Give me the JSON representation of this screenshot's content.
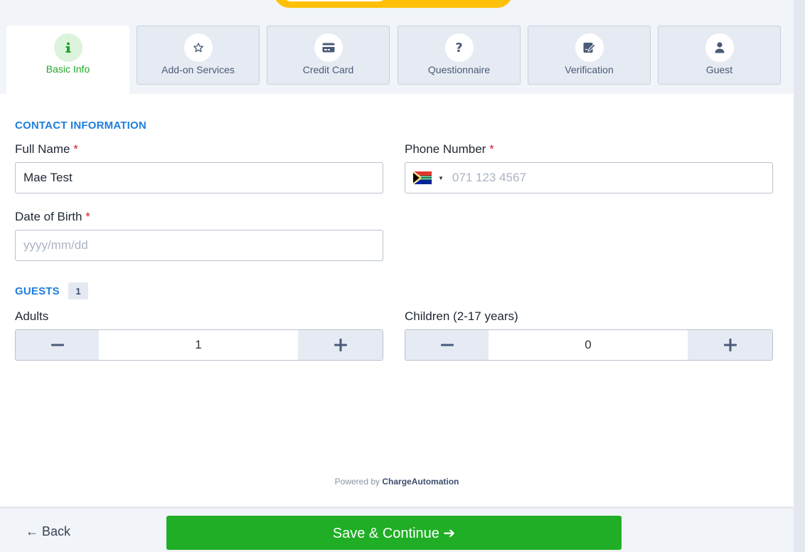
{
  "tabs": [
    {
      "label": "Basic Info",
      "icon": "info-icon",
      "active": true
    },
    {
      "label": "Add-on Services",
      "icon": "star-icon"
    },
    {
      "label": "Credit Card",
      "icon": "credit-card-icon"
    },
    {
      "label": "Questionnaire",
      "icon": "question-icon"
    },
    {
      "label": "Verification",
      "icon": "signature-icon"
    },
    {
      "label": "Guest",
      "icon": "user-icon"
    }
  ],
  "contact": {
    "title": "CONTACT INFORMATION",
    "full_name": {
      "label": "Full Name",
      "required": "*",
      "value": "Mae Test"
    },
    "phone": {
      "label": "Phone Number",
      "required": "*",
      "placeholder": "071 123 4567",
      "flag": "south-africa-flag-icon"
    },
    "dob": {
      "label": "Date of Birth",
      "required": "*",
      "placeholder": "yyyy/mm/dd"
    }
  },
  "guests": {
    "title": "GUESTS",
    "count": "1",
    "adults": {
      "label": "Adults",
      "value": "1"
    },
    "children": {
      "label": "Children (2-17 years)",
      "value": "0"
    }
  },
  "powered": {
    "prefix": "Powered by",
    "brand": "ChargeAutomation"
  },
  "footer": {
    "back_label": "← Back",
    "save_label": "Save & Continue ➔"
  },
  "colors": {
    "accent_green": "#1fae25",
    "accent_blue": "#1f7ddc",
    "required_red": "#d0202e",
    "top_pill": "#ffc107"
  }
}
